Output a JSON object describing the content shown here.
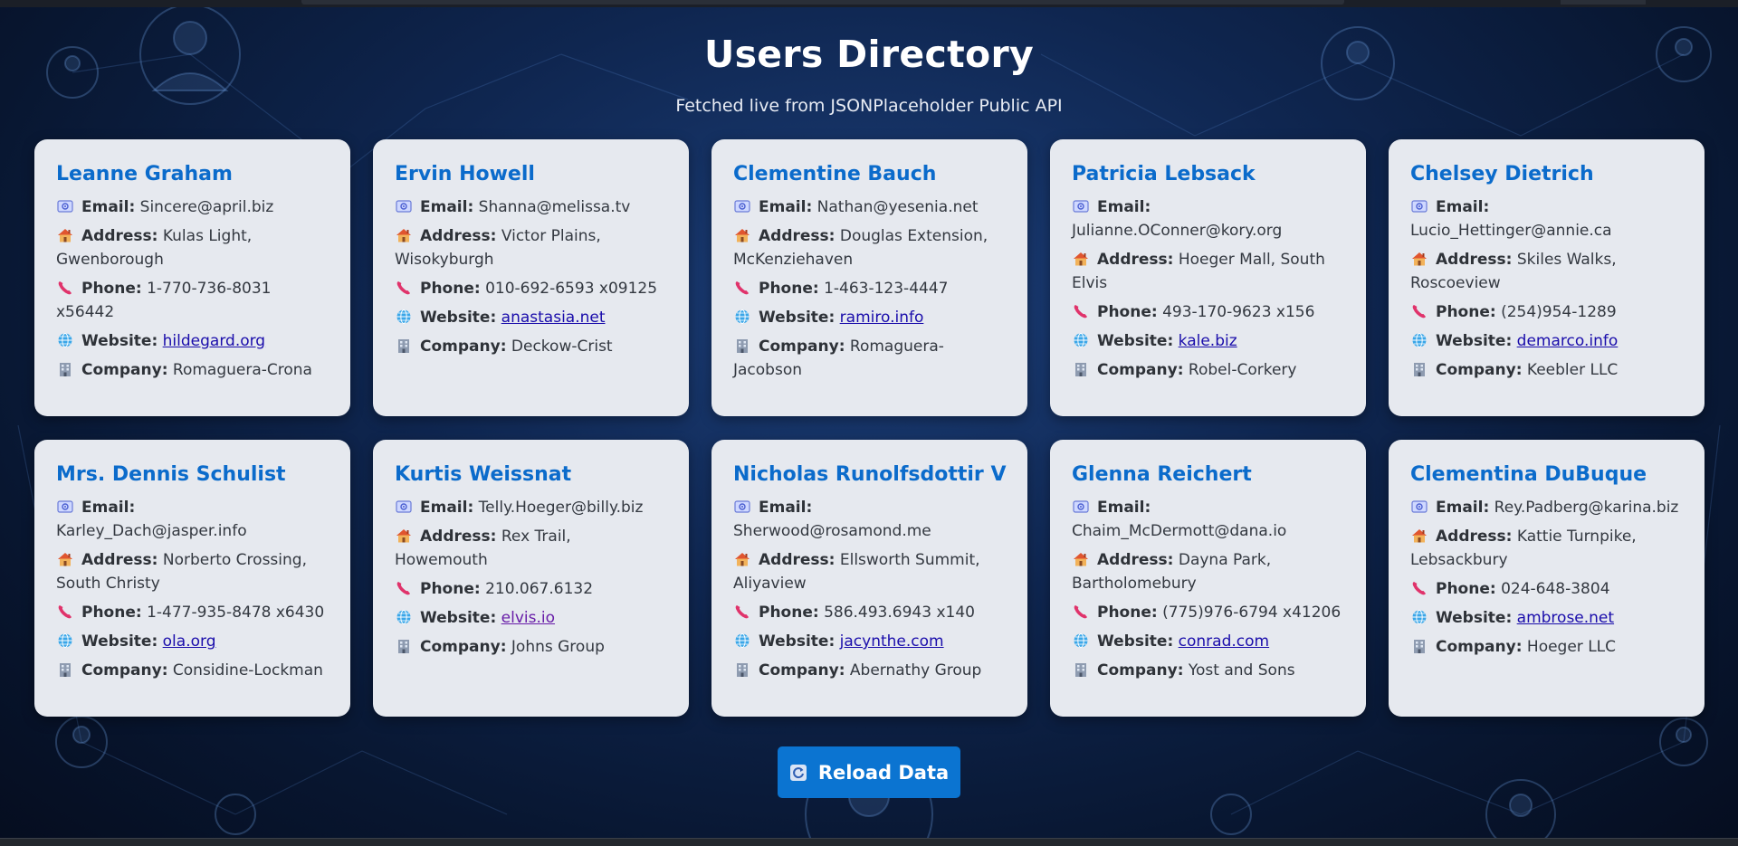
{
  "header": {
    "title": "Users Directory",
    "subtitle": "Fetched live from JSONPlaceholder Public API"
  },
  "labels": {
    "email": "Email:",
    "address": "Address:",
    "phone": "Phone:",
    "website": "Website:",
    "company": "Company:"
  },
  "icons": {
    "email": "email-icon",
    "address": "house-icon",
    "phone": "phone-icon",
    "website": "globe-icon",
    "company": "building-icon",
    "reload": "refresh-icon"
  },
  "colors": {
    "name": "#0b6bcb",
    "button": "#0b74d1",
    "card": "#e6e9ef",
    "link": "#1a0dab",
    "visited_link": "#681da8"
  },
  "users": [
    {
      "name": "Leanne Graham",
      "email": "Sincere@april.biz",
      "address": "Kulas Light, Gwenborough",
      "phone": "1-770-736-8031 x56442",
      "website": "hildegard.org",
      "company": "Romaguera-Crona"
    },
    {
      "name": "Ervin Howell",
      "email": "Shanna@melissa.tv",
      "address": "Victor Plains, Wisokyburgh",
      "phone": "010-692-6593 x09125",
      "website": "anastasia.net",
      "company": "Deckow-Crist"
    },
    {
      "name": "Clementine Bauch",
      "email": "Nathan@yesenia.net",
      "address": "Douglas Extension, McKenziehaven",
      "phone": "1-463-123-4447",
      "website": "ramiro.info",
      "company": "Romaguera-Jacobson"
    },
    {
      "name": "Patricia Lebsack",
      "email": "Julianne.OConner@kory.org",
      "address": "Hoeger Mall, South Elvis",
      "phone": "493-170-9623 x156",
      "website": "kale.biz",
      "company": "Robel-Corkery"
    },
    {
      "name": "Chelsey Dietrich",
      "email": "Lucio_Hettinger@annie.ca",
      "address": "Skiles Walks, Roscoeview",
      "phone": "(254)954-1289",
      "website": "demarco.info",
      "company": "Keebler LLC"
    },
    {
      "name": "Mrs. Dennis Schulist",
      "email": "Karley_Dach@jasper.info",
      "address": "Norberto Crossing, South Christy",
      "phone": "1-477-935-8478 x6430",
      "website": "ola.org",
      "company": "Considine-Lockman"
    },
    {
      "name": "Kurtis Weissnat",
      "email": "Telly.Hoeger@billy.biz",
      "address": "Rex Trail, Howemouth",
      "phone": "210.067.6132",
      "website": "elvis.io",
      "company": "Johns Group",
      "visited": true
    },
    {
      "name": "Nicholas Runolfsdottir V",
      "email": "Sherwood@rosamond.me",
      "address": "Ellsworth Summit, Aliyaview",
      "phone": "586.493.6943 x140",
      "website": "jacynthe.com",
      "company": "Abernathy Group"
    },
    {
      "name": "Glenna Reichert",
      "email": "Chaim_McDermott@dana.io",
      "address": "Dayna Park, Bartholomebury",
      "phone": "(775)976-6794 x41206",
      "website": "conrad.com",
      "company": "Yost and Sons"
    },
    {
      "name": "Clementina DuBuque",
      "email": "Rey.Padberg@karina.biz",
      "address": "Kattie Turnpike, Lebsackbury",
      "phone": "024-648-3804",
      "website": "ambrose.net",
      "company": "Hoeger LLC"
    }
  ],
  "reload_button": {
    "label": "Reload Data"
  }
}
